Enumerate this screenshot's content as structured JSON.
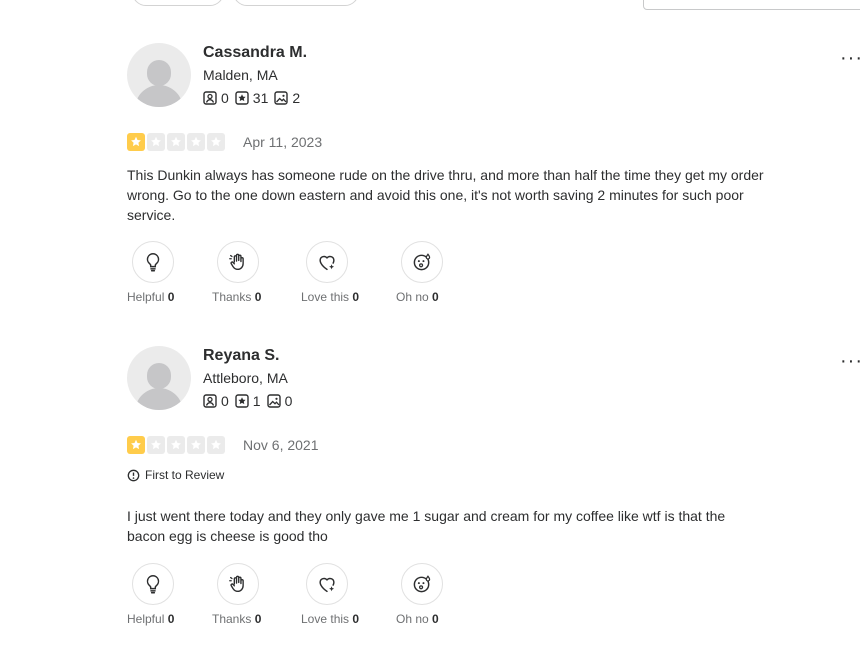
{
  "reviews": [
    {
      "name": "Cassandra M.",
      "location": "Malden, MA",
      "friends": "0",
      "review_count": "31",
      "photos": "2",
      "rating": 1,
      "date": "Apr 11, 2023",
      "badge": "",
      "text": "This Dunkin always has someone rude on the drive thru, and more than half the time they get my order wrong. Go to the one down eastern and avoid this one, it's not worth saving 2 minutes for such poor service.",
      "reactions": [
        {
          "label": "Helpful",
          "count": "0",
          "icon": "lightbulb-icon"
        },
        {
          "label": "Thanks",
          "count": "0",
          "icon": "wave-hand-icon"
        },
        {
          "label": "Love this",
          "count": "0",
          "icon": "heart-icon"
        },
        {
          "label": "Oh no",
          "count": "0",
          "icon": "surprised-face-icon"
        }
      ]
    },
    {
      "name": "Reyana S.",
      "location": "Attleboro, MA",
      "friends": "0",
      "review_count": "1",
      "photos": "0",
      "rating": 1,
      "date": "Nov 6, 2021",
      "badge": "First to Review",
      "text": "I just went there today and they only gave me 1 sugar and cream for my coffee like wtf is that the bacon egg is cheese is good tho",
      "reactions": [
        {
          "label": "Helpful",
          "count": "0",
          "icon": "lightbulb-icon"
        },
        {
          "label": "Thanks",
          "count": "0",
          "icon": "wave-hand-icon"
        },
        {
          "label": "Love this",
          "count": "0",
          "icon": "heart-icon"
        },
        {
          "label": "Oh no",
          "count": "0",
          "icon": "surprised-face-icon"
        }
      ]
    }
  ],
  "colors": {
    "star_on": "#ffcc4b",
    "star_off": "#ebebeb",
    "text": "#2d2e2f",
    "muted": "#6e7072"
  },
  "more_glyph": "···"
}
